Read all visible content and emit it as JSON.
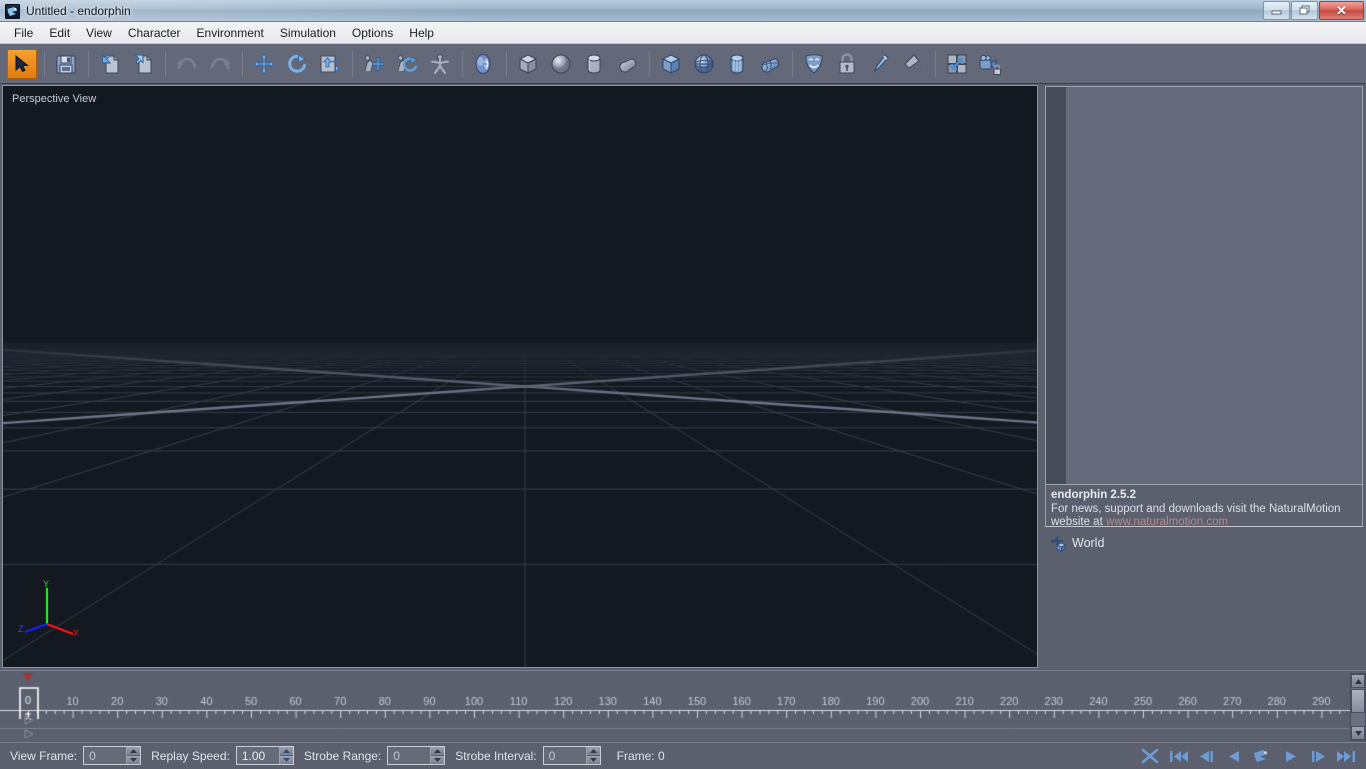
{
  "window": {
    "title": "Untitled - endorphin",
    "app_icon": "endorphin-logo-icon",
    "buttons": {
      "minimize": "minimize-icon",
      "maximize": "restore-icon",
      "close": "✕"
    }
  },
  "menubar": {
    "items": [
      {
        "label": "File"
      },
      {
        "label": "Edit"
      },
      {
        "label": "View"
      },
      {
        "label": "Character"
      },
      {
        "label": "Environment"
      },
      {
        "label": "Simulation"
      },
      {
        "label": "Options"
      },
      {
        "label": "Help"
      }
    ]
  },
  "toolbar": {
    "groups": [
      {
        "items": [
          {
            "name": "select-tool",
            "icon": "arrow-cursor-icon",
            "active": true
          }
        ]
      },
      {
        "items": [
          {
            "name": "save-file",
            "icon": "floppy-disk-icon",
            "active": false
          }
        ]
      },
      {
        "items": [
          {
            "name": "import-file",
            "icon": "import-page-icon",
            "active": false
          },
          {
            "name": "export-file",
            "icon": "export-page-icon",
            "active": false
          }
        ]
      },
      {
        "items": [
          {
            "name": "undo",
            "icon": "undo-arrow-icon",
            "active": false
          },
          {
            "name": "redo",
            "icon": "redo-arrow-icon",
            "active": false
          }
        ]
      },
      {
        "items": [
          {
            "name": "translate-tool",
            "icon": "move-cross-arrows-icon",
            "active": false
          },
          {
            "name": "rotate-tool",
            "icon": "rotate-arrow-icon",
            "active": false
          },
          {
            "name": "transform-tool",
            "icon": "transform-box-icon",
            "active": false
          }
        ]
      },
      {
        "items": [
          {
            "name": "move-body-part",
            "icon": "body-move-icon",
            "active": false
          },
          {
            "name": "rotate-body-part",
            "icon": "body-rotate-icon",
            "active": false
          },
          {
            "name": "add-character",
            "icon": "stick-figure-icon",
            "active": false
          }
        ]
      },
      {
        "items": [
          {
            "name": "head-view",
            "icon": "blue-head-icon",
            "active": false
          }
        ]
      },
      {
        "items": [
          {
            "name": "add-box",
            "icon": "grey-cube-icon",
            "active": false
          },
          {
            "name": "add-sphere",
            "icon": "grey-sphere-icon",
            "active": false
          },
          {
            "name": "add-cylinder",
            "icon": "grey-cylinder-icon",
            "active": false
          },
          {
            "name": "add-capsule",
            "icon": "grey-capsule-icon",
            "active": false
          }
        ]
      },
      {
        "items": [
          {
            "name": "add-dynamic-box",
            "icon": "blue-cube-icon",
            "active": false
          },
          {
            "name": "add-dynamic-sphere",
            "icon": "blue-wire-sphere-icon",
            "active": false
          },
          {
            "name": "add-dynamic-cylinder",
            "icon": "blue-cylinder-icon",
            "active": false
          },
          {
            "name": "add-dynamic-capsule",
            "icon": "blue-capsule-icon",
            "active": false
          }
        ]
      },
      {
        "items": [
          {
            "name": "behaviour-mask",
            "icon": "theatre-mask-icon",
            "active": false
          },
          {
            "name": "lock-object",
            "icon": "padlock-icon",
            "active": false
          },
          {
            "name": "paint-tool",
            "icon": "pen-nib-icon",
            "active": false
          },
          {
            "name": "wedge-tool",
            "icon": "wedge-magnifier-icon",
            "active": false
          }
        ]
      },
      {
        "items": [
          {
            "name": "fit-view",
            "icon": "fit-to-view-icon",
            "active": false
          },
          {
            "name": "lock-camera",
            "icon": "camera-lock-icon",
            "active": false
          }
        ]
      }
    ]
  },
  "viewport": {
    "label": "Perspective View",
    "background_color": "#141821",
    "grid_color": "#3a3f4d",
    "axis_line_color": "#6f7488",
    "gizmo": {
      "x_label": "X",
      "x_color": "#ff1010",
      "y_label": "Y",
      "y_color": "#12f012",
      "z_label": "Z",
      "z_color": "#1020ff"
    }
  },
  "right_panel": {
    "info": {
      "title": "endorphin 2.5.2",
      "line1": "For news, support and downloads visit the NaturalMotion",
      "line2_prefix": "website at ",
      "link": "www.naturalmotion.com"
    },
    "tree": [
      {
        "label": "World",
        "icon": "world-axis-cube-icon"
      }
    ]
  },
  "timeline": {
    "ticks": [
      0,
      10,
      20,
      30,
      40,
      50,
      60,
      70,
      80,
      90,
      100,
      110,
      120,
      130,
      140,
      150,
      160,
      170,
      180,
      190,
      200,
      210,
      220,
      230,
      240,
      250,
      260,
      270,
      280,
      290
    ],
    "playhead_frame": 0,
    "tick_label_color": "#c7cad3",
    "scrollbar": {
      "up": "▲",
      "down": "▼"
    }
  },
  "statusbar": {
    "fields": [
      {
        "name": "view-frame",
        "label": "View Frame:",
        "value": "0",
        "dim": true
      },
      {
        "name": "replay-speed",
        "label": "Replay Speed:",
        "value": "1.00",
        "dim": false
      },
      {
        "name": "strobe-range",
        "label": "Strobe Range:",
        "value": "0",
        "dim": true
      },
      {
        "name": "strobe-interval",
        "label": "Strobe Interval:",
        "value": "0",
        "dim": true
      }
    ],
    "frame_readout": "Frame: 0",
    "transport": [
      {
        "name": "transport-shuttle",
        "icon": "shuttle-cross-icon"
      },
      {
        "name": "transport-first-frame",
        "icon": "skip-to-start-icon"
      },
      {
        "name": "transport-prev-frame",
        "icon": "step-back-icon"
      },
      {
        "name": "transport-play-reverse",
        "icon": "play-reverse-icon"
      },
      {
        "name": "transport-simulate",
        "icon": "endorphin-simulate-icon"
      },
      {
        "name": "transport-play",
        "icon": "play-icon"
      },
      {
        "name": "transport-next-frame",
        "icon": "step-forward-icon"
      },
      {
        "name": "transport-last-frame",
        "icon": "skip-to-end-icon"
      }
    ]
  }
}
